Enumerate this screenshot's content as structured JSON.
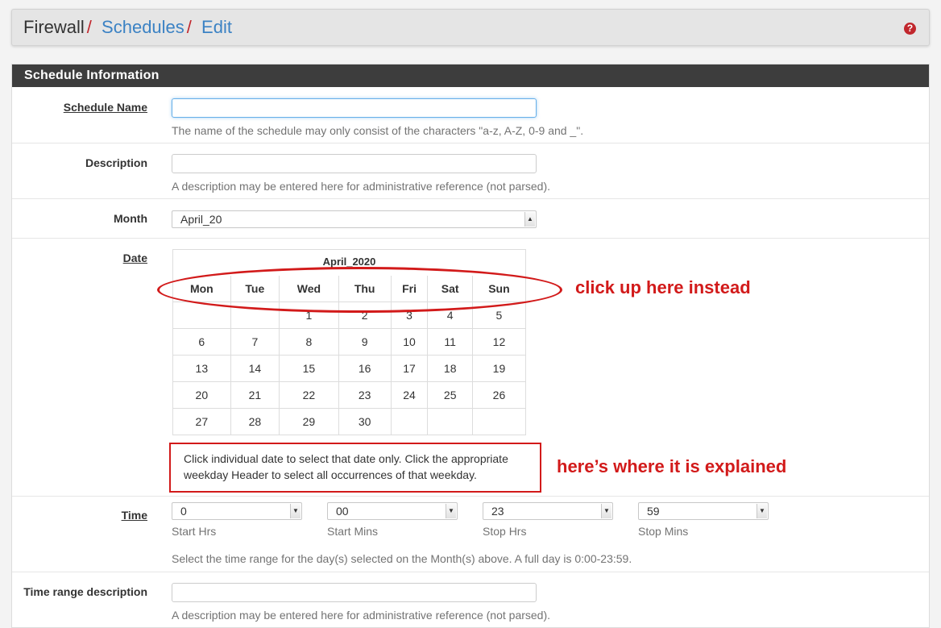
{
  "breadcrumb": {
    "current": "Firewall",
    "schedules": "Schedules",
    "edit": "Edit",
    "sep": "/"
  },
  "help_icon": {
    "glyph": "?"
  },
  "panel": {
    "title": "Schedule Information"
  },
  "schedule_name": {
    "label": "Schedule Name",
    "value": "",
    "help": "The name of the schedule may only consist of the characters \"a-z, A-Z, 0-9 and _\"."
  },
  "description": {
    "label": "Description",
    "value": "",
    "help": "A description may be entered here for administrative reference (not parsed)."
  },
  "month": {
    "label": "Month",
    "value": "April_20"
  },
  "date": {
    "label": "Date",
    "calendar_title": "April_2020",
    "weekdays": [
      "Mon",
      "Tue",
      "Wed",
      "Thu",
      "Fri",
      "Sat",
      "Sun"
    ],
    "weeks": [
      [
        "",
        "",
        "1",
        "2",
        "3",
        "4",
        "5"
      ],
      [
        "6",
        "7",
        "8",
        "9",
        "10",
        "11",
        "12"
      ],
      [
        "13",
        "14",
        "15",
        "16",
        "17",
        "18",
        "19"
      ],
      [
        "20",
        "21",
        "22",
        "23",
        "24",
        "25",
        "26"
      ],
      [
        "27",
        "28",
        "29",
        "30",
        "",
        "",
        ""
      ]
    ],
    "note": "Click individual date to select that date only. Click the appropriate weekday Header to select all occurrences of that weekday."
  },
  "annotations": {
    "header_hint": "click up here instead",
    "note_hint": "here’s where it is explained"
  },
  "time": {
    "label": "Time",
    "fields": [
      {
        "value": "0",
        "label": "Start Hrs"
      },
      {
        "value": "00",
        "label": "Start Mins"
      },
      {
        "value": "23",
        "label": "Stop Hrs"
      },
      {
        "value": "59",
        "label": "Stop Mins"
      }
    ],
    "help": "Select the time range for the day(s) selected on the Month(s) above. A full day is 0:00-23:59."
  },
  "time_range_description": {
    "label": "Time range description",
    "value": "",
    "help": "A description may be entered here for administrative reference (not parsed)."
  },
  "colors": {
    "accent": "#3b82c4",
    "annotation": "#d21a1a",
    "panel_header": "#3d3d3d"
  }
}
